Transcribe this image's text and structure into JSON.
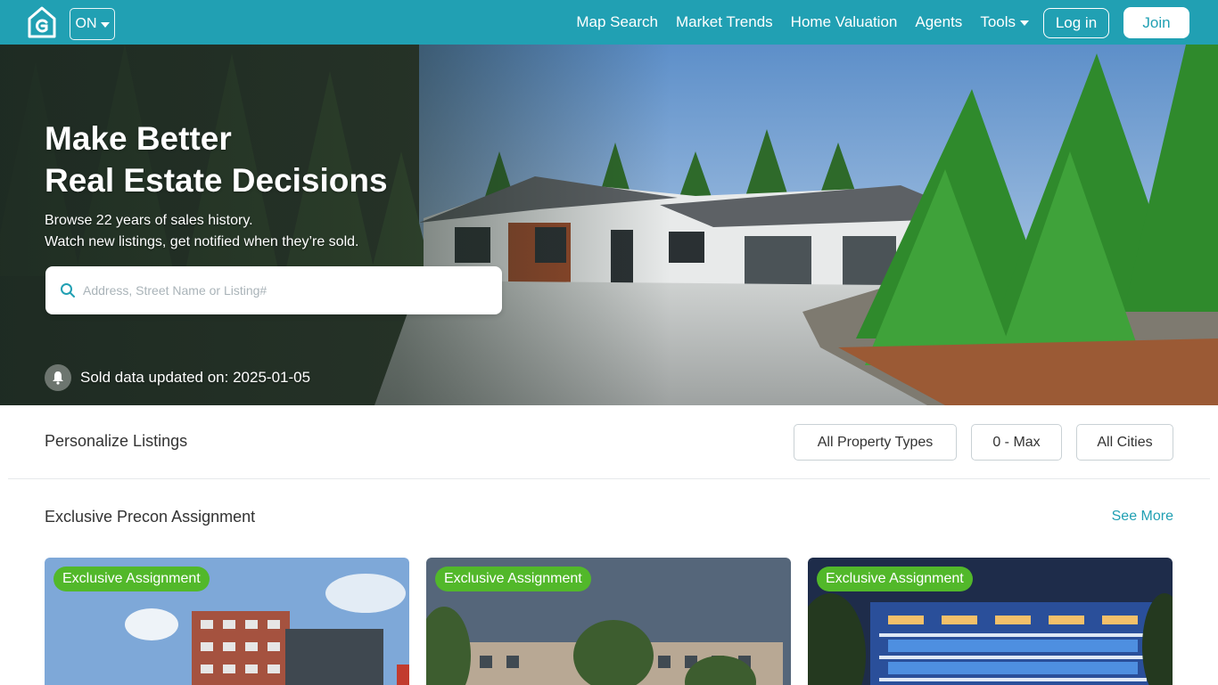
{
  "nav": {
    "province": "ON",
    "links": [
      {
        "label": "Map Search"
      },
      {
        "label": "Market Trends"
      },
      {
        "label": "Home Valuation"
      },
      {
        "label": "Agents"
      },
      {
        "label": "Tools"
      }
    ],
    "login": "Log in",
    "join": "Join",
    "logo_icon": "house-logo-icon"
  },
  "hero": {
    "title_line1": "Make Better",
    "title_line2": "Real Estate Decisions",
    "sub_line1": "Browse 22 years of sales history.",
    "sub_line2": "Watch new listings, get notified when they’re sold.",
    "search_placeholder": "Address, Street Name or Listing#",
    "sold_updated": "Sold data updated on: 2025-01-05"
  },
  "personalize": {
    "title": "Personalize Listings",
    "filters": [
      "All Property Types",
      "0 - Max",
      "All Cities"
    ]
  },
  "precon": {
    "title": "Exclusive Precon Assignment",
    "see_more": "See More",
    "cards": [
      {
        "badge": "Exclusive Assignment"
      },
      {
        "badge": "Exclusive Assignment"
      },
      {
        "badge": "Exclusive Assignment"
      }
    ]
  },
  "colors": {
    "brand": "#21a0b3",
    "badge": "#52b82a"
  }
}
